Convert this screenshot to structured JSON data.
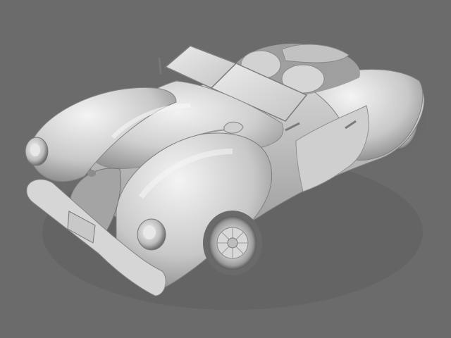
{
  "scene": {
    "subject": "vintage-roadster-clay-render",
    "colors": {
      "background": "#6b6b6b",
      "body_light": "#e6e6e6",
      "body_mid": "#bdbdbd",
      "body_shadow": "#8a8a8a",
      "deep_shadow": "#4a4a4a"
    }
  }
}
